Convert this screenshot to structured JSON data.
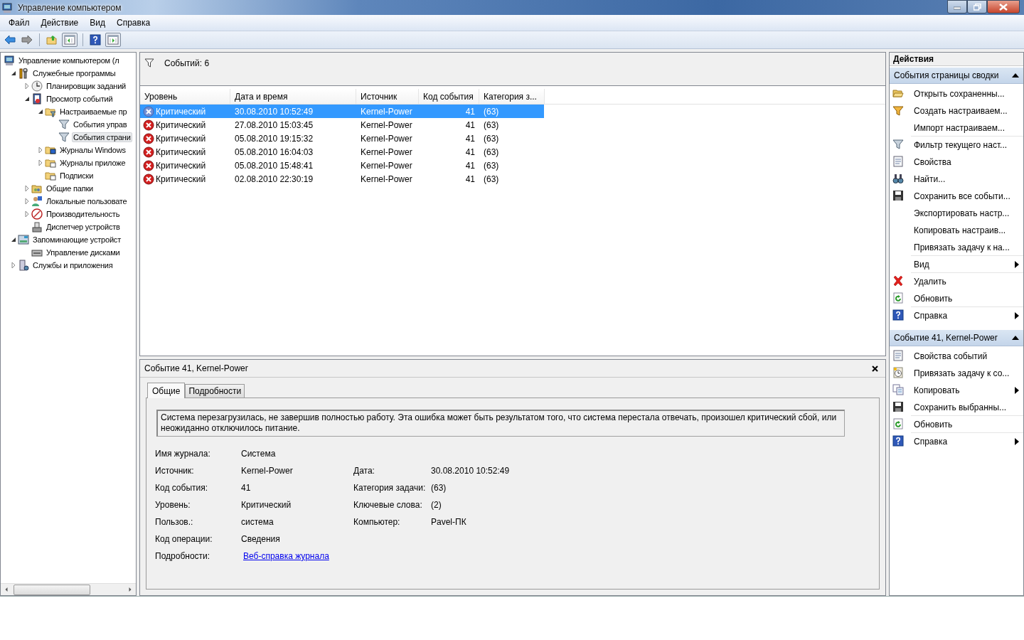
{
  "window": {
    "title": "Управление компьютером"
  },
  "menu": [
    "Файл",
    "Действие",
    "Вид",
    "Справка"
  ],
  "tree": [
    {
      "label": "Управление компьютером (л",
      "selected": false,
      "children": [
        {
          "label": "Служебные программы",
          "expanded": true,
          "selected": false,
          "children": [
            {
              "label": "Планировщик заданий",
              "expanded": false,
              "selected": false
            },
            {
              "label": "Просмотр событий",
              "expanded": true,
              "selected": false,
              "children": [
                {
                  "label": "Настраиваемые пр",
                  "expanded": true,
                  "selected": false,
                  "children": [
                    {
                      "label": "События управ",
                      "selected": false
                    },
                    {
                      "label": "События страни",
                      "selected": true
                    }
                  ]
                },
                {
                  "label": "Журналы Windows",
                  "expanded": false,
                  "selected": false
                },
                {
                  "label": "Журналы приложе",
                  "expanded": false,
                  "selected": false
                },
                {
                  "label": "Подписки",
                  "selected": false
                }
              ]
            },
            {
              "label": "Общие папки",
              "expanded": false,
              "selected": false
            },
            {
              "label": "Локальные пользовате",
              "expanded": false,
              "selected": false
            },
            {
              "label": "Производительность",
              "expanded": false,
              "selected": false
            },
            {
              "label": "Диспетчер устройств",
              "selected": false
            }
          ]
        },
        {
          "label": "Запоминающие устройст",
          "expanded": true,
          "selected": false,
          "children": [
            {
              "label": "Управление дисками",
              "selected": false
            }
          ]
        },
        {
          "label": "Службы и приложения",
          "expanded": false,
          "selected": false
        }
      ]
    }
  ],
  "events_header": {
    "count": "Событий: 6"
  },
  "table": {
    "columns": [
      "Уровень",
      "Дата и время",
      "Источник",
      "Код события",
      "Категория з..."
    ],
    "rows": [
      {
        "level": "Критический",
        "datetime": "30.08.2010 10:52:49",
        "source": "Kernel-Power",
        "code": "41",
        "category": "(63)",
        "selected": true
      },
      {
        "level": "Критический",
        "datetime": "27.08.2010 15:03:45",
        "source": "Kernel-Power",
        "code": "41",
        "category": "(63)",
        "selected": false
      },
      {
        "level": "Критический",
        "datetime": "05.08.2010 19:15:32",
        "source": "Kernel-Power",
        "code": "41",
        "category": "(63)",
        "selected": false
      },
      {
        "level": "Критический",
        "datetime": "05.08.2010 16:04:03",
        "source": "Kernel-Power",
        "code": "41",
        "category": "(63)",
        "selected": false
      },
      {
        "level": "Критический",
        "datetime": "05.08.2010 15:48:41",
        "source": "Kernel-Power",
        "code": "41",
        "category": "(63)",
        "selected": false
      },
      {
        "level": "Критический",
        "datetime": "02.08.2010 22:30:19",
        "source": "Kernel-Power",
        "code": "41",
        "category": "(63)",
        "selected": false
      }
    ]
  },
  "details": {
    "title": "Событие 41, Kernel-Power",
    "tabs": [
      {
        "label": "Общие",
        "selected": true
      },
      {
        "label": "Подробности",
        "selected": false
      }
    ],
    "description": "Система перезагрузилась, не завершив полностью работу. Эта ошибка может быть результатом того, что система перестала отвечать, произошел критический сбой, или неожиданно отключилось питание.",
    "field_rows": [
      {
        "cells": [
          {
            "label": "Имя журнала:",
            "value": "Система",
            "kind": "text"
          }
        ]
      },
      {
        "cells": [
          {
            "label": "Источник:",
            "value": "Kernel-Power",
            "kind": "text"
          },
          {
            "label": "Дата:",
            "value": "30.08.2010 10:52:49",
            "kind": "text"
          }
        ]
      },
      {
        "cells": [
          {
            "label": "Код события:",
            "value": "41",
            "kind": "text"
          },
          {
            "label": "Категория задачи:",
            "value": "(63)",
            "kind": "text"
          }
        ]
      },
      {
        "cells": [
          {
            "label": "Уровень:",
            "value": "Критический",
            "kind": "text"
          },
          {
            "label": "Ключевые слова:",
            "value": "(2)",
            "kind": "text"
          }
        ]
      },
      {
        "cells": [
          {
            "label": "Пользов.:",
            "value": "система",
            "kind": "text"
          },
          {
            "label": "Компьютер:",
            "value": "Pavel-ПК",
            "kind": "text"
          }
        ]
      },
      {
        "cells": [
          {
            "label": "Код операции:",
            "value": "Сведения",
            "kind": "text"
          }
        ]
      },
      {
        "cells": [
          {
            "label": "Подробности:",
            "value": "Веб-справка журнала ",
            "kind": "link"
          }
        ]
      }
    ]
  },
  "actions": {
    "title": "Действия",
    "sections": [
      {
        "title": "События страницы сводки",
        "expanded": true,
        "items": [
          {
            "label": "Открыть сохраненны...",
            "submenu": false,
            "separator": false
          },
          {
            "label": "Создать настраиваем...",
            "submenu": false,
            "separator": false
          },
          {
            "label": "Импорт настраиваем...",
            "submenu": false,
            "separator": true
          },
          {
            "label": "Фильтр текущего наст...",
            "submenu": false,
            "separator": false
          },
          {
            "label": "Свойства",
            "submenu": false,
            "separator": false
          },
          {
            "label": "Найти...",
            "submenu": false,
            "separator": false
          },
          {
            "label": "Сохранить все событи...",
            "submenu": false,
            "separator": false
          },
          {
            "label": "Экспортировать настр...",
            "submenu": false,
            "separator": false
          },
          {
            "label": "Копировать настраив...",
            "submenu": false,
            "separator": false
          },
          {
            "label": "Привязать задачу к на...",
            "submenu": false,
            "separator": true
          },
          {
            "label": "Вид",
            "submenu": true,
            "separator": true
          },
          {
            "label": "Удалить",
            "submenu": false,
            "separator": false
          },
          {
            "label": "Обновить",
            "submenu": false,
            "separator": true
          },
          {
            "label": "Справка",
            "submenu": true,
            "separator": false
          }
        ]
      },
      {
        "title": "Событие 41, Kernel-Power",
        "expanded": true,
        "items": [
          {
            "label": "Свойства событий",
            "submenu": false,
            "separator": false
          },
          {
            "label": "Привязать задачу к со...",
            "submenu": false,
            "separator": false
          },
          {
            "label": "Копировать",
            "submenu": true,
            "separator": false
          },
          {
            "label": "Сохранить выбранны...",
            "submenu": false,
            "separator": true
          },
          {
            "label": "Обновить",
            "submenu": false,
            "separator": true
          },
          {
            "label": "Справка",
            "submenu": true,
            "separator": false
          }
        ]
      }
    ]
  }
}
